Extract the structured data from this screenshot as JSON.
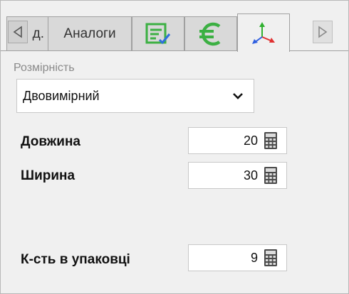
{
  "tabs": {
    "partial_label": "д.",
    "analogs_label": "Аналоги",
    "doc_icon": "document-check-icon",
    "euro_icon": "euro-icon",
    "axes_icon": "axes-3d-icon",
    "active_tab": "axes"
  },
  "dimensionality": {
    "label": "Розмірність",
    "selected": "Двовимірний"
  },
  "fields": {
    "length": {
      "label": "Довжина",
      "value": "20"
    },
    "width": {
      "label": "Ширина",
      "value": "30"
    },
    "pack_qty": {
      "label": "К-сть в упаковці",
      "value": "9"
    }
  },
  "colors": {
    "doc_icon_green": "#3cb043",
    "euro_green": "#3cb043",
    "axis_red": "#e03030",
    "axis_green": "#30b030",
    "axis_blue": "#3060e0"
  }
}
